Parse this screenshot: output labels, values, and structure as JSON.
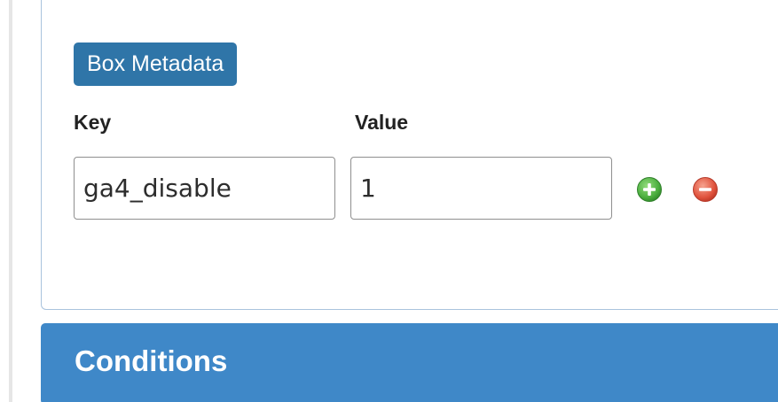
{
  "panel": {
    "badge_label": "Box Metadata",
    "key_label": "Key",
    "value_label": "Value",
    "row": {
      "key_value": "ga4_disable",
      "value_value": "1"
    },
    "icons": {
      "add": "plus-circle-icon",
      "remove": "minus-circle-icon"
    }
  },
  "conditions": {
    "title": "Conditions"
  },
  "colors": {
    "badge": "#2f75a8",
    "section_header": "#3f88c8",
    "add_icon": "#46a53f",
    "remove_icon": "#dd4b39",
    "panel_border": "#a9c3dd"
  }
}
